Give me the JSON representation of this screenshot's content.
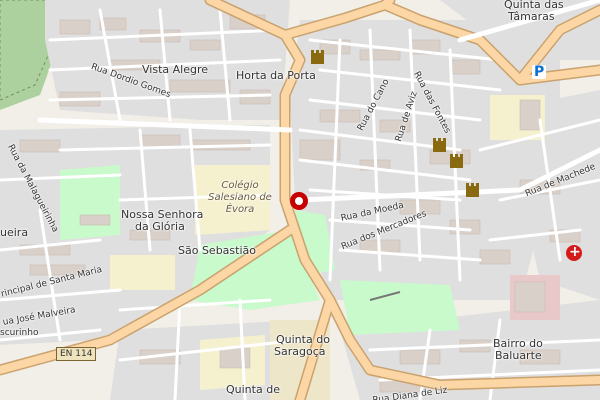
{
  "map": {
    "colors": {
      "background": "#f2efe9",
      "residential": "#e0dfdf",
      "buildings": "#d9d0c9",
      "park": "#c8facc",
      "wood": "#add19e",
      "primary_road": "#fcd6a4",
      "road_casing": "#c9a26e",
      "street": "#ffffff",
      "marker": "#c60000",
      "hospital": "#d41b1b",
      "parking": "#0b70d0"
    },
    "places": {
      "vista_alegre": "Vista Alegre",
      "horta_da_porta": "Horta da Porta",
      "quinta_das_tamaras_1": "Quinta das",
      "quinta_das_tamaras_2": "Tâmaras",
      "nossa_senhora_1": "Nossa Senhora",
      "nossa_senhora_2": "da Glória",
      "sao_sebastiao": "São Sebastião",
      "quinta_saragoca_1": "Quinta do",
      "quinta_saragoca_2": "Saragoça",
      "bairro_baluarte_1": "Bairro do",
      "bairro_baluarte_2": "Baluarte",
      "quinta_de": "Quinta de",
      "ueira": "ueira"
    },
    "colegio": {
      "line1": "Colégio",
      "line2": "Salesiano de",
      "line3": "Évora"
    },
    "streets": {
      "dordio_gomes": "Rua Dordio Gomes",
      "malagueirinha": "Rua da Malagueirinha",
      "do_cano": "Rua do Cano",
      "de_aviz": "Rua de Aviz",
      "das_fontes": "Rua das Fontes",
      "da_moeda": "Rua da Moeda",
      "dos_mercadores": "Rua dos Mercadores",
      "de_machede": "Rua de Machede",
      "principal_santa_maria": "rincipal de Santa Maria",
      "jose_malveira": "ua José Malveira",
      "escurinho": "scurinho",
      "diana_de_liz": "Rua Diana de Liz"
    },
    "road_ref": "EN 114",
    "parking_symbol": "P",
    "hospital_symbol": "+"
  }
}
